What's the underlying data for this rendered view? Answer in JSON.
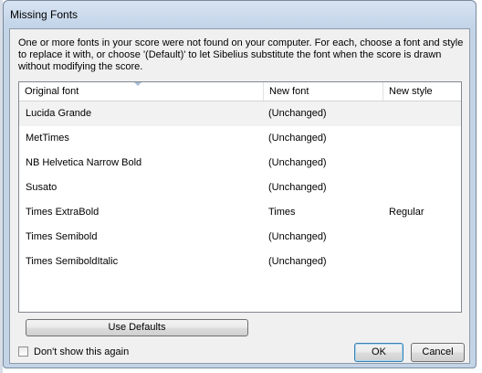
{
  "window": {
    "title": "Missing Fonts"
  },
  "message": "One or more fonts in your score were not found on your computer. For each, choose a font and style to replace it with, or choose '(Default)' to let Sibelius substitute the font when the score is drawn without modifying the score.",
  "table": {
    "columns": [
      "Original font",
      "New font",
      "New style"
    ],
    "rows": [
      {
        "original": "Lucida Grande",
        "new_font": "(Unchanged)",
        "new_style": ""
      },
      {
        "original": "MetTimes",
        "new_font": "(Unchanged)",
        "new_style": ""
      },
      {
        "original": "NB Helvetica Narrow Bold",
        "new_font": "(Unchanged)",
        "new_style": ""
      },
      {
        "original": "Susato",
        "new_font": "(Unchanged)",
        "new_style": ""
      },
      {
        "original": "Times ExtraBold",
        "new_font": "Times",
        "new_style": "Regular"
      },
      {
        "original": "Times Semibold",
        "new_font": "(Unchanged)",
        "new_style": ""
      },
      {
        "original": "Times SemiboldItalic",
        "new_font": "(Unchanged)",
        "new_style": ""
      }
    ],
    "selected_row": 0
  },
  "buttons": {
    "use_defaults": "Use Defaults",
    "ok": "OK",
    "cancel": "Cancel"
  },
  "checkbox": {
    "label": "Don't show this again",
    "checked": false
  }
}
